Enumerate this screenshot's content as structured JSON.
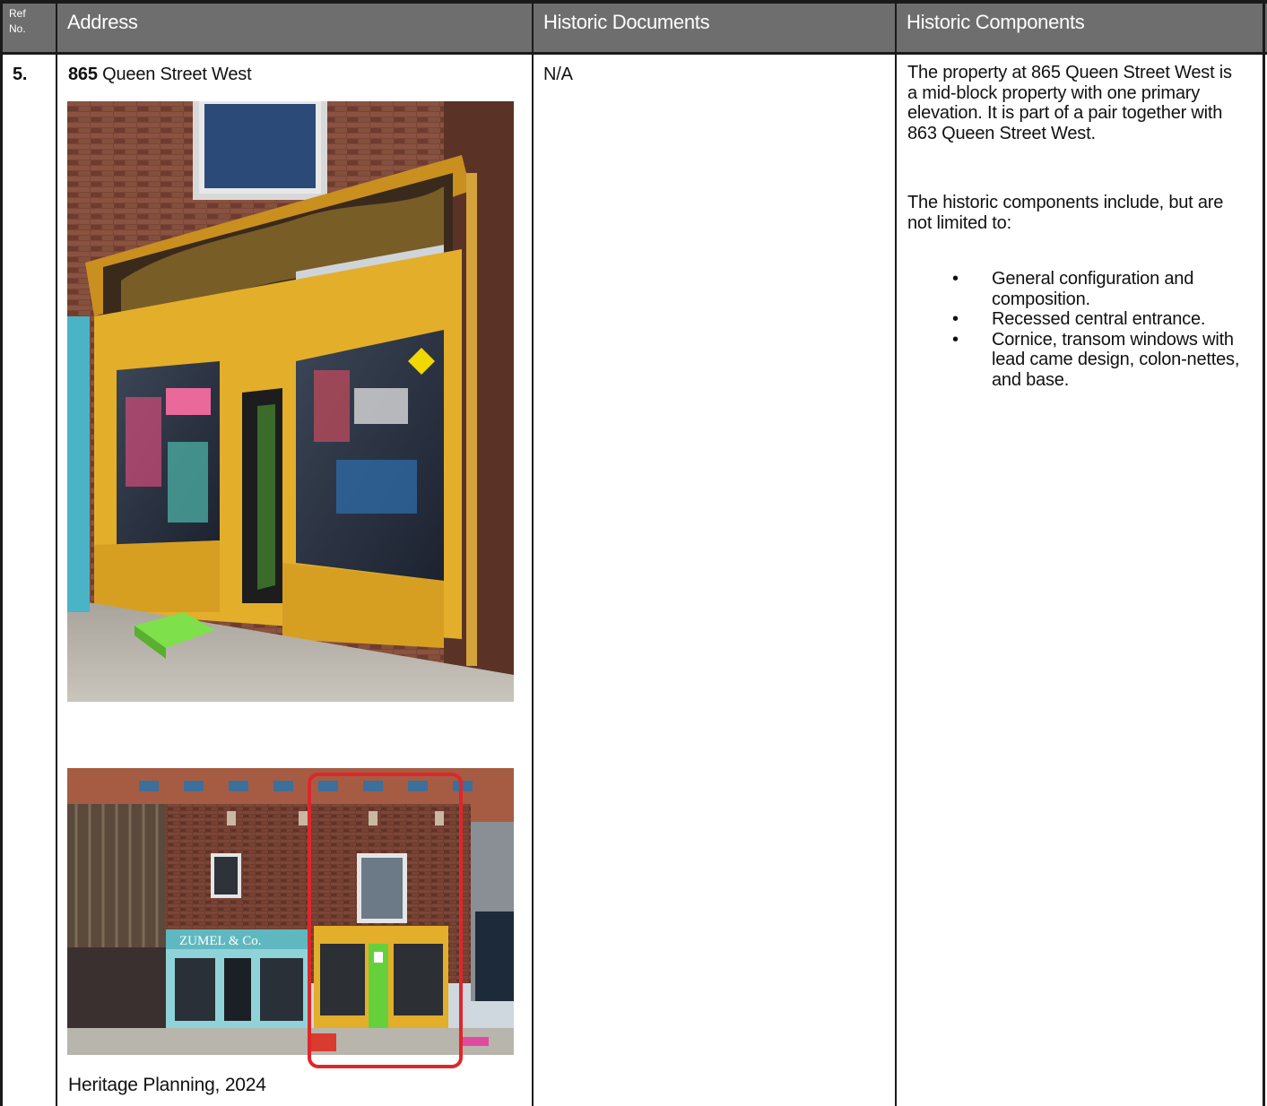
{
  "table": {
    "headers": {
      "ref": "Ref\nNo.",
      "ref_line1": "Ref",
      "ref_line2": "No.",
      "address": "Address",
      "documents": "Historic Documents",
      "components": "Historic Components"
    },
    "row": {
      "ref_no": "5.",
      "address_number": "865",
      "address_street": " Queen Street West",
      "historic_documents": "N/A",
      "components_description": "The property at 865 Queen Street West is a mid-block property with one primary elevation. It is part of a pair together with 863 Queen Street West.",
      "components_intro": "The historic components include, but are not limited to:",
      "components_list": [
        "General configuration and composition.",
        "Recessed central entrance.",
        "Cornice, transom windows with lead came design, colon-nettes, and base."
      ],
      "photo_caption": "Heritage Planning, 2024",
      "photo2_sign_text": "ZUMEL & Co."
    }
  },
  "colors": {
    "header_bg": "#6e6e6e",
    "border": "#1a1a1a",
    "highlight": "#e0262b",
    "storefront_yellow": "#e3ae2a",
    "neighbour_blue": "#8fd3d8"
  }
}
